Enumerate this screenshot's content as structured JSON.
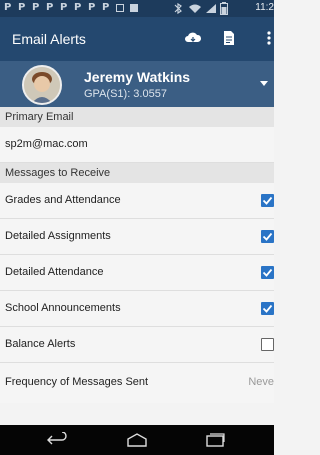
{
  "status_bar": {
    "notification_letters": [
      "P",
      "P",
      "P",
      "P",
      "P",
      "P",
      "P",
      "P"
    ],
    "time": "11:2"
  },
  "app_bar": {
    "title": "Email Alerts",
    "icons": [
      "cloud-icon",
      "document-icon",
      "overflow-menu-icon"
    ]
  },
  "profile": {
    "name": "Jeremy Watkins",
    "gpa": "GPA(S1): 3.0557"
  },
  "primary_email": {
    "header": "Primary Email",
    "value": "sp2m@mac.com"
  },
  "messages": {
    "header": "Messages to Receive",
    "items": [
      {
        "label": "Grades and Attendance",
        "checked": true
      },
      {
        "label": "Detailed Assignments",
        "checked": true
      },
      {
        "label": "Detailed Attendance",
        "checked": true
      },
      {
        "label": "School Announcements",
        "checked": true
      },
      {
        "label": "Balance Alerts",
        "checked": false
      }
    ]
  },
  "frequency": {
    "label": "Frequency of Messages Sent",
    "value": "Neve"
  },
  "nav_bar": {
    "icons": [
      "back-icon",
      "home-icon",
      "recent-apps-icon"
    ]
  },
  "colors": {
    "status_bar": "#1d3b5c",
    "app_bar": "#24486f",
    "profile_bar": "#3b5e84",
    "checkbox_checked": "#2a74c6"
  }
}
